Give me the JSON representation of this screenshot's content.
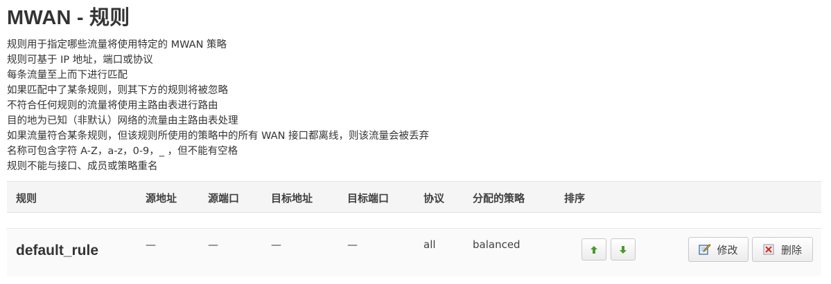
{
  "page": {
    "title": "MWAN - 规则"
  },
  "description": [
    "规则用于指定哪些流量将使用特定的 MWAN 策略",
    "规则可基于 IP 地址，端口或协议",
    "每条流量至上而下进行匹配",
    "如果匹配中了某条规则，则其下方的规则将被忽略",
    "不符合任何规则的流量将使用主路由表进行路由",
    "目的地为已知（非默认）网络的流量由主路由表处理",
    "如果流量符合某条规则，但该规则所使用的策略中的所有 WAN 接口都离线，则该流量会被丢弃",
    "名称可包含字符 A-Z，a-z，0-9，_ ，但不能有空格",
    "规则不能与接口、成员或策略重名"
  ],
  "table": {
    "headers": {
      "rule": "规则",
      "src_ip": "源地址",
      "src_port": "源端口",
      "dest_ip": "目标地址",
      "dest_port": "目标端口",
      "proto": "协议",
      "policy": "分配的策略",
      "sort": "排序"
    },
    "rows": [
      {
        "name": "default_rule",
        "src_ip": "—",
        "src_port": "—",
        "dest_ip": "—",
        "dest_port": "—",
        "proto": "all",
        "policy": "balanced"
      }
    ]
  },
  "actions": {
    "edit_label": "修改",
    "delete_label": "删除"
  },
  "icons": {
    "move_up": "arrow-up-icon",
    "move_down": "arrow-down-icon",
    "edit": "edit-icon",
    "delete": "delete-icon"
  },
  "colors": {
    "arrow_green": "#4a9a2a",
    "delete_red": "#c9302c",
    "edit_blue": "#3a6ea5"
  }
}
